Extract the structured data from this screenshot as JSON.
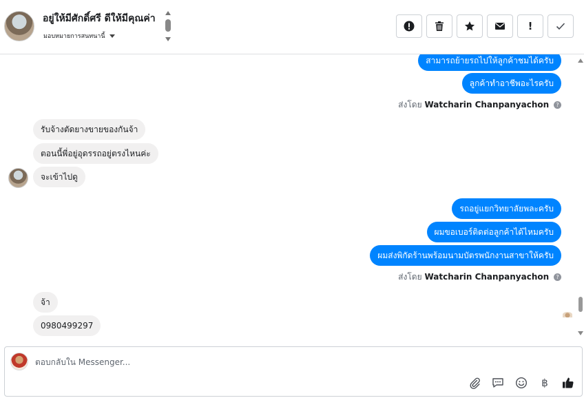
{
  "header": {
    "title": "อยู่ให้มีศักดิ์ศรี ดีให้มีคุณค่า",
    "assign_label": "มอบหมายการสนทนานี้"
  },
  "toolbar": {
    "buttons": [
      {
        "icon": "alert-circle-icon"
      },
      {
        "icon": "trash-icon"
      },
      {
        "icon": "star-icon"
      },
      {
        "icon": "envelope-icon"
      },
      {
        "icon": "exclamation-icon",
        "glyph": "!"
      },
      {
        "icon": "checkmark-icon"
      }
    ]
  },
  "messages": {
    "group1": [
      "สามารถย้ายรถไปให้ลูกค้าชมได้ครับ",
      "ลูกค้าทำอาชีพอะไรครับ"
    ],
    "group2": [
      "รับจ้างตัดยางขายของกันจ้า",
      "ตอนนี้พี่อยู่อุดรรถอยู่ตรงไหนค่ะ",
      "จะเข้าไปดู"
    ],
    "group3": [
      "รถอยู่แยกวิทยาลัยพละครับ",
      "ผมขอเบอร์ติดต่อลูกค้าได้ไหมครับ",
      "ผมส่งพิกัดร้านพร้อมนามบัตรพนักงานสาขาให้ครับ"
    ],
    "group4": [
      "จ้า",
      "0980499297"
    ],
    "sent_by_prefix": "ส่งโดย",
    "sent_by_name": "Watcharin Chanpanyachon",
    "help_glyph": "?"
  },
  "composer": {
    "placeholder": "ตอบกลับใน Messenger...",
    "icons": [
      "attachment-icon",
      "saved-replies-icon",
      "emoji-icon",
      "payment-icon",
      "like-icon"
    ],
    "payment_glyph": "฿"
  }
}
